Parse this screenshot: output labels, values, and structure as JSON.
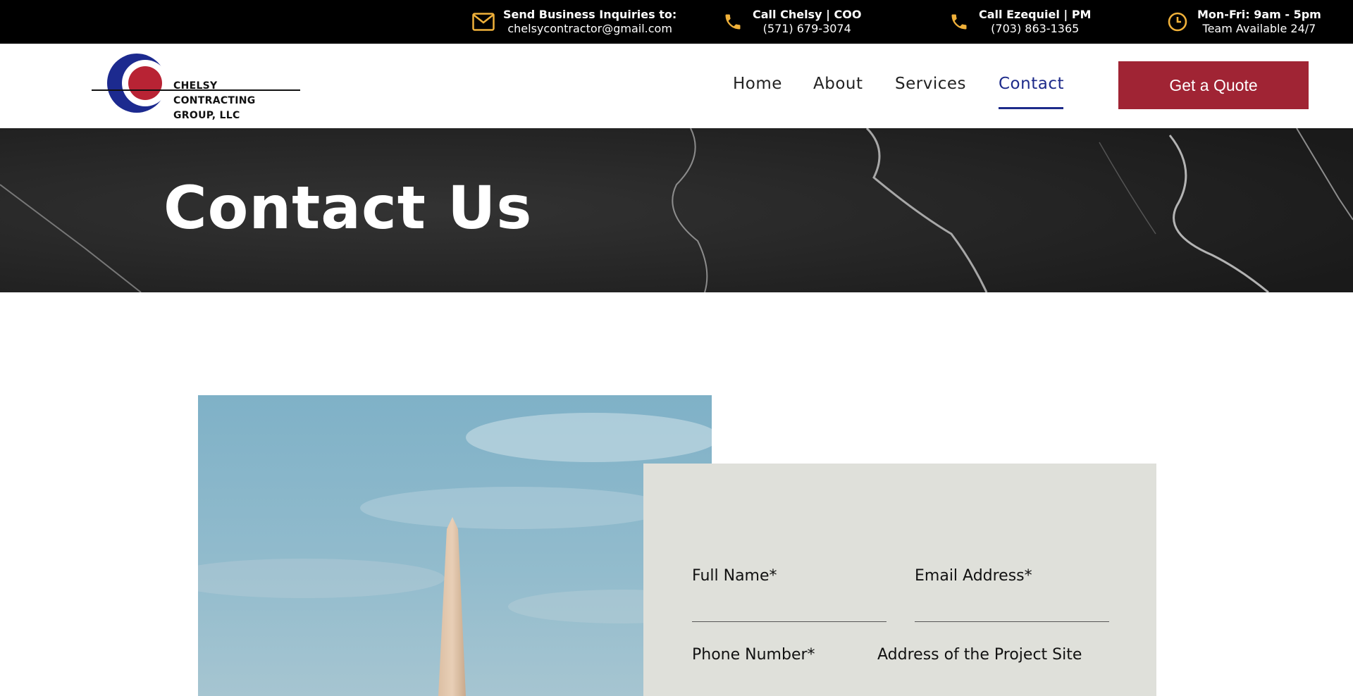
{
  "topbar": {
    "email": {
      "title": "Send Business Inquiries to:",
      "value": "chelsycontractor@gmail.com",
      "icon": "mail-icon"
    },
    "phone1": {
      "title": "Call Chelsy | COO",
      "value": "(571) 679-3074",
      "icon": "phone-icon"
    },
    "phone2": {
      "title": "Call Ezequiel | PM",
      "value": "(703) 863-1365",
      "icon": "phone-icon"
    },
    "hours": {
      "title": "Mon-Fri: 9am - 5pm",
      "value": "Team Available 24/7",
      "icon": "clock-icon"
    },
    "icon_color": "#f0b13a"
  },
  "header": {
    "logo_line1": "CHELSY CONTRACTING",
    "logo_line2": "GROUP, LLC",
    "nav": [
      {
        "label": "Home"
      },
      {
        "label": "About"
      },
      {
        "label": "Services"
      },
      {
        "label": "Contact",
        "active": true
      }
    ],
    "cta": "Get a Quote",
    "accent": "#1d2a8a",
    "cta_color": "#a02434"
  },
  "hero": {
    "title": "Contact Us"
  },
  "form": {
    "full_name": "Full Name*",
    "email": "Email Address*",
    "phone": "Phone Number*",
    "address": "Address of the Project Site"
  }
}
